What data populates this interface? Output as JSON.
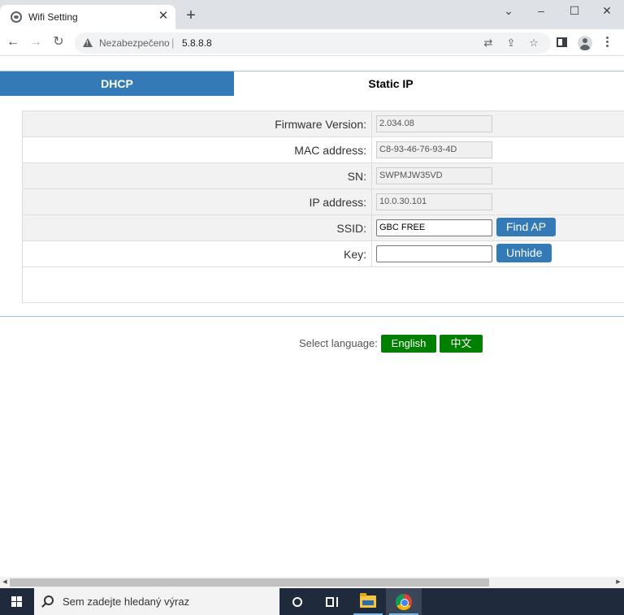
{
  "browser": {
    "tab_title": "Wifi Setting",
    "tab_close": "✕",
    "new_tab": "+",
    "window_controls": {
      "minimize": "–",
      "maximize": "☐",
      "close": "✕",
      "dropdown": "⌄"
    },
    "security_label": "Nezabezpečeno",
    "url_separator": "|",
    "url": "5.8.8.8"
  },
  "page": {
    "tabs": [
      {
        "label": "DHCP",
        "active": true
      },
      {
        "label": "Static IP",
        "active": false
      }
    ],
    "rows": [
      {
        "label": "Firmware Version:",
        "value": "2.034.08",
        "readonly": true
      },
      {
        "label": "MAC address:",
        "value": "C8-93-46-76-93-4D",
        "readonly": true
      },
      {
        "label": "SN:",
        "value": "SWPMJW35VD",
        "readonly": true
      },
      {
        "label": "IP address:",
        "value": "10.0.30.101",
        "readonly": true
      },
      {
        "label": "SSID:",
        "value": "GBC FREE",
        "readonly": false,
        "button": "Find AP"
      },
      {
        "label": "Key:",
        "value": "",
        "readonly": false,
        "button": "Unhide"
      }
    ],
    "language": {
      "label": "Select language:",
      "options": [
        "English",
        "中文"
      ]
    }
  },
  "taskbar": {
    "search_placeholder": "Sem zadejte hledaný výraz"
  },
  "colors": {
    "primary": "#337ab7",
    "language_button": "#008000",
    "taskbar": "#1f2a3c"
  }
}
